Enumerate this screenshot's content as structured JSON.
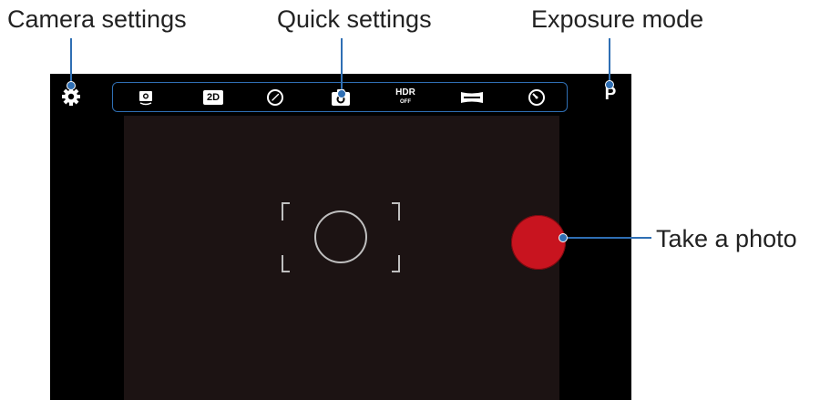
{
  "callouts": {
    "camera_settings": "Camera settings",
    "quick_settings": "Quick settings",
    "exposure_mode": "Exposure mode",
    "take_photo": "Take a photo"
  },
  "topbar": {
    "settings_icon": "gear-icon",
    "exposure_mode_value": "P",
    "quick_settings": [
      {
        "icon": "self-shot-icon"
      },
      {
        "icon": "2d-mode-icon",
        "label": "2D"
      },
      {
        "icon": "effects-icon"
      },
      {
        "icon": "shooting-mode-icon"
      },
      {
        "icon": "hdr-icon",
        "label": "HDR",
        "sublabel": "OFF"
      },
      {
        "icon": "panorama-icon"
      },
      {
        "icon": "timer-icon"
      }
    ]
  },
  "colors": {
    "accent": "#2f6fb4",
    "shutter": "#c8141f",
    "screen_bg": "#000000",
    "viewfinder_bg": "#1c1313"
  }
}
